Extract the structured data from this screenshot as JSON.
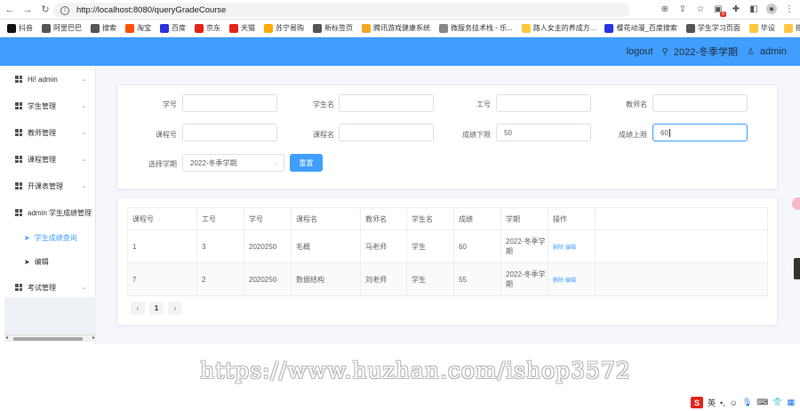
{
  "browser": {
    "url": "http://localhost:8080/queryGradeCourse",
    "extension_badge": "3",
    "bookmarks": [
      "抖音",
      "阿里巴巴",
      "搜索",
      "淘宝",
      "百度",
      "京东",
      "天猫",
      "苏宁易购",
      "新标签页",
      "腾讯游戏健康系统",
      "微服务技术栈 - 乐...",
      "路人女主的养成方...",
      "樱花动漫_百度搜索",
      "学生学习页面",
      "毕设",
      "搭建"
    ],
    "bookmark_colors": [
      "#111111",
      "#555555",
      "#555555",
      "#ff5000",
      "#2932e1",
      "#e1251b",
      "#e1251b",
      "#ffaa00",
      "#555555",
      "#f5a623",
      "#888888",
      "#ffc83d",
      "#2932e1",
      "#555555",
      "#ffc83d",
      "#ffc83d"
    ]
  },
  "header": {
    "logout": "logout",
    "term": "2022-冬季学期",
    "user": "admin",
    "accent": "#409eff"
  },
  "sidebar": {
    "items": [
      {
        "label": "Hi! admin"
      },
      {
        "label": "学生管理"
      },
      {
        "label": "教师管理"
      },
      {
        "label": "课程管理"
      },
      {
        "label": "开课表管理"
      },
      {
        "label": "admin 学生成绩管理"
      }
    ],
    "subitems": [
      {
        "label": "学生成绩查询",
        "active": true
      },
      {
        "label": "编辑",
        "active": false
      }
    ],
    "last": {
      "label": "考试管理"
    }
  },
  "search": {
    "student_id": {
      "label": "学号",
      "value": ""
    },
    "student_name": {
      "label": "学生名",
      "value": ""
    },
    "teacher_id": {
      "label": "工号",
      "value": ""
    },
    "teacher_name": {
      "label": "教师名",
      "value": ""
    },
    "course_id": {
      "label": "课程号",
      "value": ""
    },
    "course_name": {
      "label": "课程名",
      "value": ""
    },
    "grade_min": {
      "label": "成绩下限",
      "value": "50"
    },
    "grade_max": {
      "label": "成绩上限",
      "value": "60"
    },
    "term_select": {
      "label": "选择学期",
      "value": "2022-冬季学期"
    },
    "reset_label": "重置"
  },
  "table": {
    "headers": [
      "课程号",
      "工号",
      "学号",
      "课程名",
      "教师名",
      "学生名",
      "成绩",
      "学期",
      "操作"
    ],
    "rows": [
      [
        "1",
        "3",
        "2020250",
        "毛概",
        "马老师",
        "学生",
        "60",
        "2022-冬季学期"
      ],
      [
        "7",
        "2",
        "2020250",
        "数据结构",
        "刘老师",
        "学生",
        "55",
        "2022-冬季学期"
      ]
    ],
    "op_delete": "删除",
    "op_edit": "编辑"
  },
  "pagination": {
    "prev": "‹",
    "current": "1",
    "next": "›"
  },
  "watermark": "https://www.huzhan.com/ishop3572",
  "ime": {
    "logo": "S",
    "mode": "英"
  }
}
